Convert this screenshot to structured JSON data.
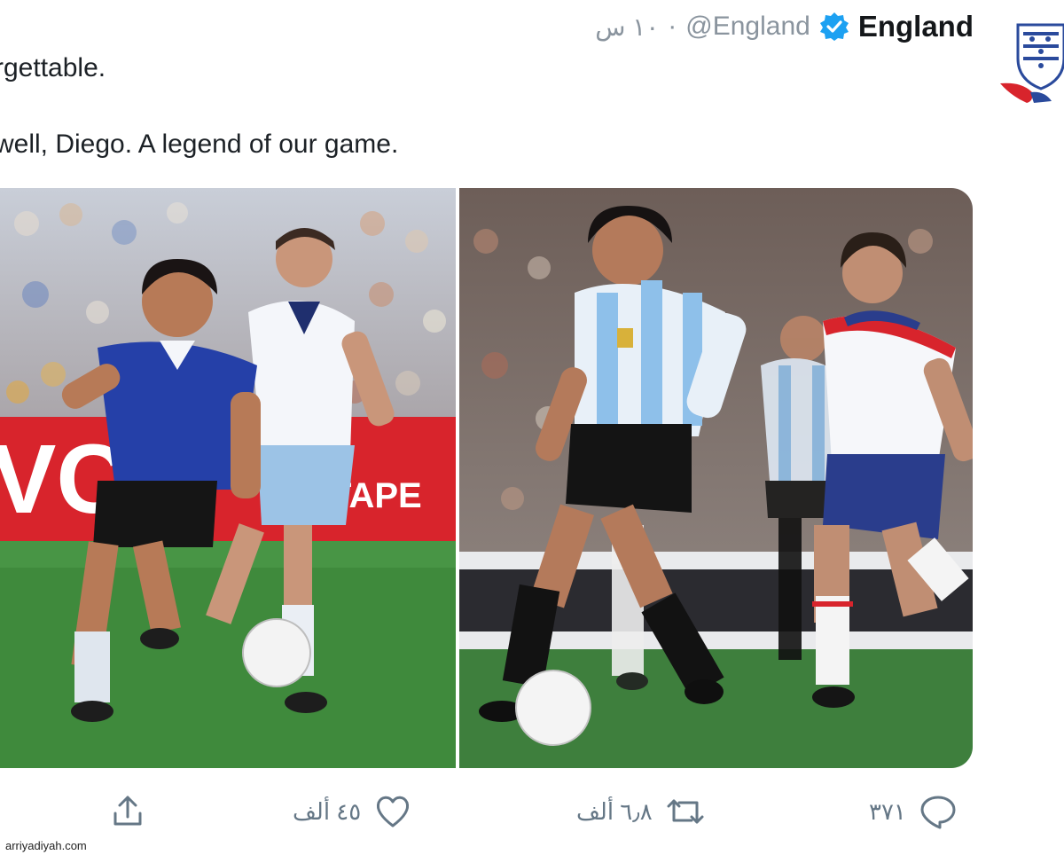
{
  "tweet": {
    "author_name": "England",
    "handle": "@England",
    "separator": "·",
    "time": "١٠ س",
    "text_line_1": "rgettable.",
    "text_line_2": "well, Diego. A legend of our game."
  },
  "media": {
    "left_photo": {
      "board_left_text": "VC",
      "board_right_text": "TAPE"
    },
    "right_photo": {}
  },
  "actions": {
    "reply_count": "٣٧١",
    "retweet_count": "٦٫٨ ألف",
    "like_count": "٤٥ ألف"
  },
  "watermark": "arriyadiyah.com",
  "colors": {
    "background": "#ffffff",
    "text": "#14171a",
    "muted": "#657786",
    "verified": "#1da1f2",
    "board_red": "#d8242c",
    "pitch_green": "#3f8a3c"
  }
}
